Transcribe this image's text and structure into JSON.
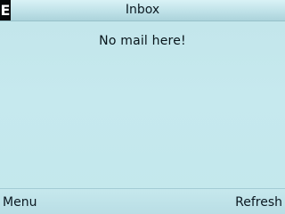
{
  "app": {
    "badge": "E",
    "title": "Inbox"
  },
  "inbox": {
    "empty_message": "No mail here!"
  },
  "softkeys": {
    "left_label": "Menu",
    "right_label": "Refresh"
  },
  "colors": {
    "background": "#c4e7ec",
    "titlebar": "#bfe2e8",
    "badge": "#050708",
    "text": "#0b1820"
  }
}
